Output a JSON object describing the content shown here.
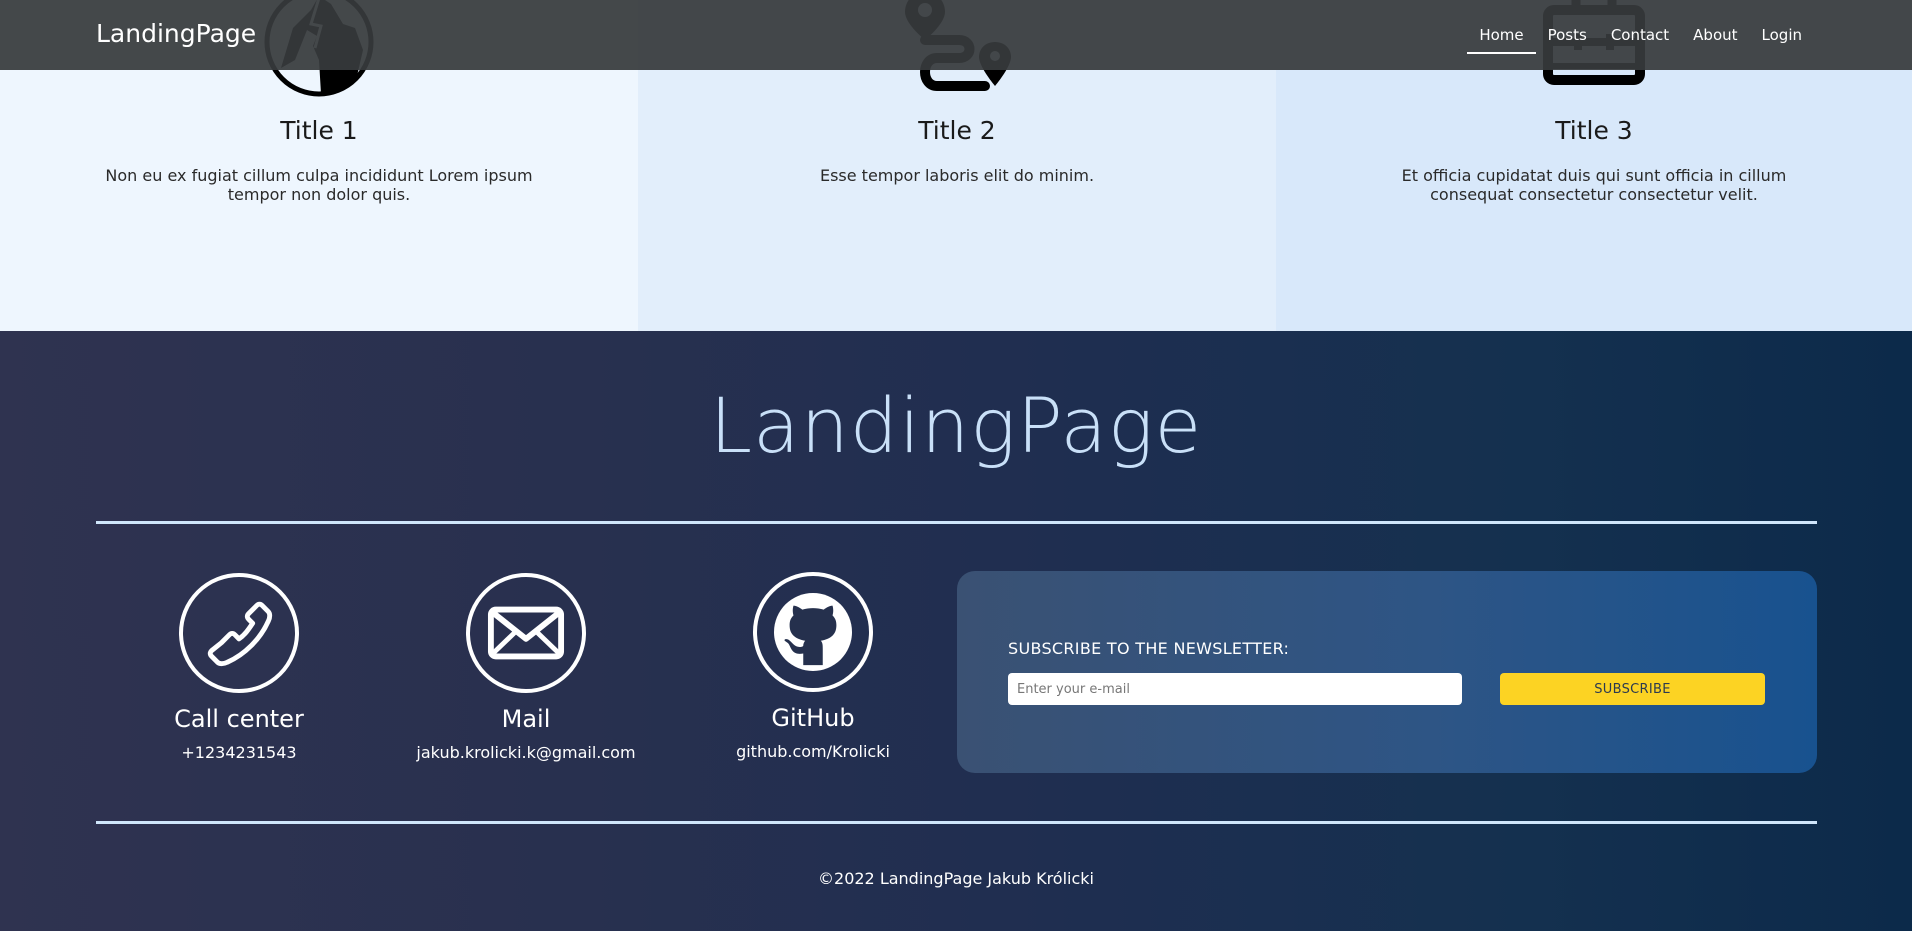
{
  "navbar": {
    "brand": "LandingPage",
    "links": [
      {
        "label": "Home",
        "active": true
      },
      {
        "label": "Posts"
      },
      {
        "label": "Contact"
      },
      {
        "label": "About"
      },
      {
        "label": "Login"
      }
    ]
  },
  "features": [
    {
      "icon": "mountain-icon",
      "title": "Title 1",
      "text": "Non eu ex fugiat cillum culpa incididunt Lorem ipsum tempor non dolor quis."
    },
    {
      "icon": "route-icon",
      "title": "Title 2",
      "text": "Esse tempor laboris elit do minim."
    },
    {
      "icon": "briefcase-icon",
      "title": "Title 3",
      "text": "Et officia cupidatat duis qui sunt officia in cillum consequat consectetur consectetur velit."
    }
  ],
  "footer": {
    "brand": "LandingPage",
    "contacts": [
      {
        "icon": "phone-icon",
        "title": "Call center",
        "value": "+1234231543"
      },
      {
        "icon": "mail-icon",
        "title": "Mail",
        "value": "jakub.krolicki.k@gmail.com"
      },
      {
        "icon": "github-icon",
        "title": "GitHub",
        "value": "github.com/Krolicki"
      }
    ],
    "newsletter": {
      "label": "SUBSCRIBE TO THE NEWSLETTER:",
      "placeholder": "Enter your e-mail",
      "value": "",
      "button": "SUBSCRIBE"
    },
    "copyright": "©2022 LandingPage Jakub Królicki"
  },
  "colors": {
    "navbar_bg": "#373a3c",
    "accent_button": "#fcd323",
    "footer_brand": "#c9e0f8",
    "divider": "#cfe6fb"
  }
}
